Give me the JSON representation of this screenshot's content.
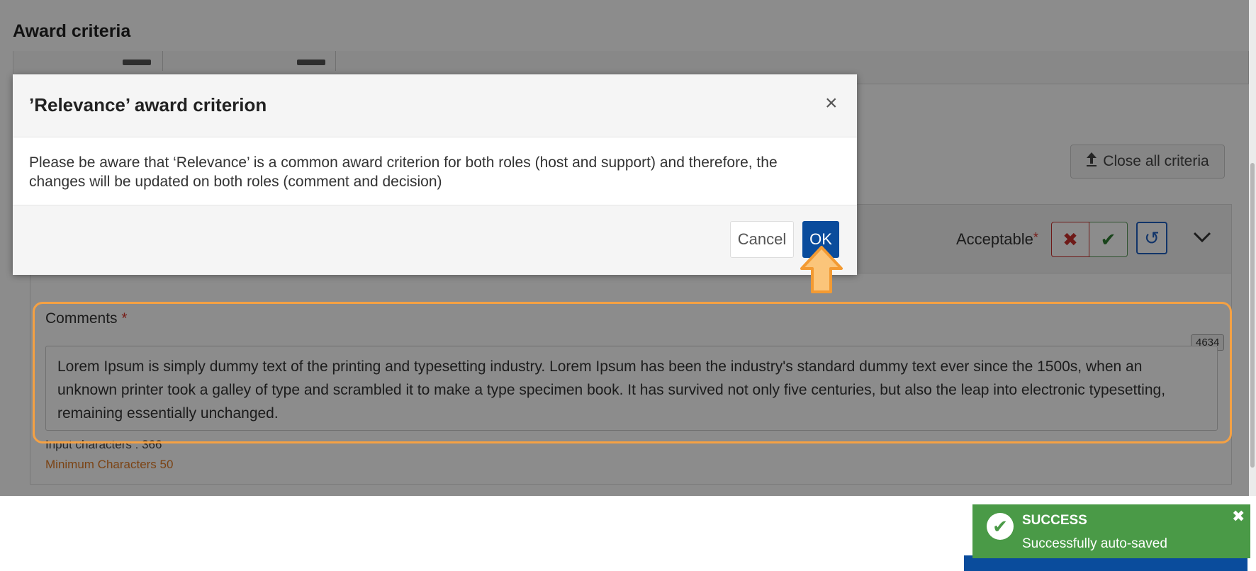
{
  "page": {
    "title": "Award criteria",
    "close_all_label": "Close all criteria",
    "close_all_icon": "upload-arrow-icon",
    "acceptable_label": "Acceptable",
    "required_mark": "*",
    "reject_icon": "✖",
    "accept_icon": "✔",
    "reset_icon": "↺",
    "collapse_icon": "⌄",
    "comments_label": "Comments",
    "char_counter": "4634",
    "comment_text": "Lorem Ipsum is simply dummy text of the printing and typesetting industry. Lorem Ipsum has been the industry's standard dummy text ever since the 1500s, when an unknown printer took a galley of type and scrambled it to make a type specimen book. It has survived not only five centuries, but also the leap into electronic typesetting, remaining essentially unchanged.",
    "input_characters": "Input characters : 366",
    "minimum_characters": "Minimum Characters 50"
  },
  "modal": {
    "title": "’Relevance’ award criterion",
    "close_icon": "×",
    "message": "Please be aware that ‘Relevance’ is a common award criterion for both roles (host and support) and therefore, the changes will be updated on both roles (comment and decision)",
    "cancel_label": "Cancel",
    "ok_label": "OK"
  },
  "toast": {
    "title": "SUCCESS",
    "message": "Successfully auto-saved",
    "check_icon": "✔",
    "close_icon": "✖"
  },
  "colors": {
    "primary_blue": "#0a4c9c",
    "highlight_orange": "#f5a143",
    "success_green": "#4a9a47",
    "danger_red": "#c9302c"
  }
}
